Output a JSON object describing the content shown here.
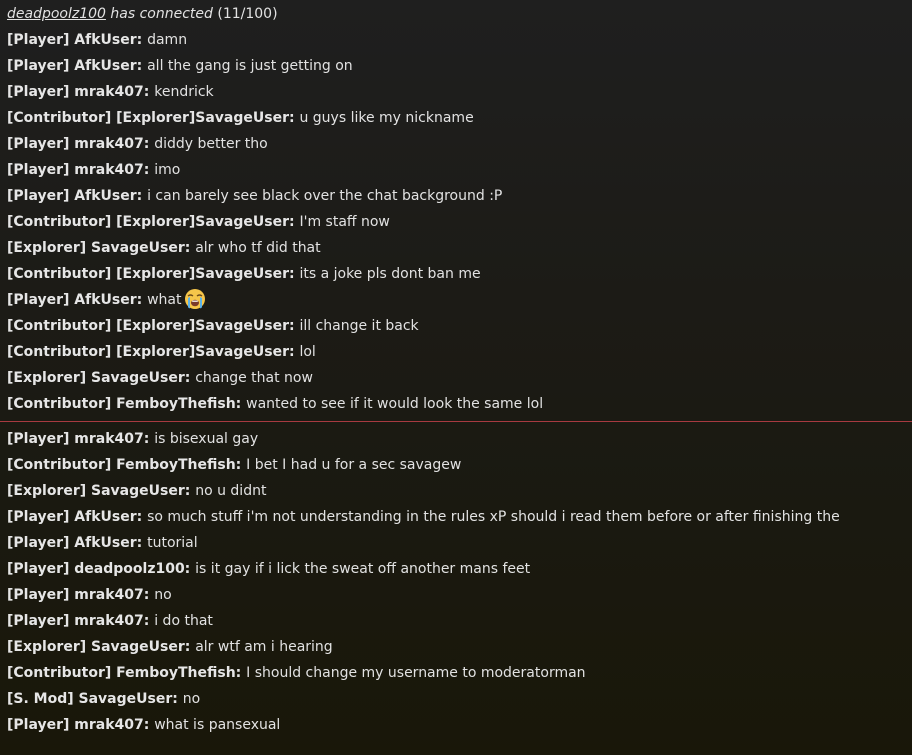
{
  "connection": {
    "user": "deadpoolz100",
    "text": " has connected",
    "count": " (11/100)"
  },
  "messages": [
    {
      "sender": "[Player] AfkUser:",
      "text": "damn"
    },
    {
      "sender": "[Player] AfkUser:",
      "text": "all the gang is just getting on"
    },
    {
      "sender": "[Player] mrak407:",
      "text": "kendrick"
    },
    {
      "sender": "[Contributor] [Explorer]SavageUser:",
      "text": "u guys like my nickname"
    },
    {
      "sender": "[Player] mrak407:",
      "text": "diddy better tho"
    },
    {
      "sender": "[Player] mrak407:",
      "text": "imo"
    },
    {
      "sender": "[Player] AfkUser:",
      "text": "i can barely see black over the chat background :P"
    },
    {
      "sender": "[Contributor] [Explorer]SavageUser:",
      "text": "I'm staff now"
    },
    {
      "sender": "[Explorer] SavageUser:",
      "text": "alr who tf did that"
    },
    {
      "sender": "[Contributor] [Explorer]SavageUser:",
      "text": "its a joke pls dont ban me"
    },
    {
      "sender": "[Player] AfkUser:",
      "text": "what",
      "emoji": "loudly-crying-face-icon"
    },
    {
      "sender": "[Contributor] [Explorer]SavageUser:",
      "text": "ill change it back"
    },
    {
      "sender": "[Contributor] [Explorer]SavageUser:",
      "text": "lol"
    },
    {
      "sender": "[Explorer] SavageUser:",
      "text": "change that now"
    },
    {
      "sender": "[Contributor] FemboyThefish:",
      "text": "wanted to see if it would look the same lol"
    },
    {
      "sender": "[Player] mrak407:",
      "text": "is bisexual gay"
    },
    {
      "sender": "[Contributor] FemboyThefish:",
      "text": "I bet I had u for a sec savagew"
    },
    {
      "sender": "[Explorer] SavageUser:",
      "text": "no u didnt"
    },
    {
      "sender": "[Player] AfkUser:",
      "text": "so much stuff i'm not understanding in the rules xP should i read them before or after finishing the"
    },
    {
      "sender": "[Player] AfkUser:",
      "text": "tutorial"
    },
    {
      "sender": "[Player] deadpoolz100:",
      "text": "is it gay if i lick the sweat off another mans feet"
    },
    {
      "sender": "[Player] mrak407:",
      "text": "no"
    },
    {
      "sender": "[Player] mrak407:",
      "text": "i do that"
    },
    {
      "sender": "[Explorer] SavageUser:",
      "text": "alr wtf am i hearing"
    },
    {
      "sender": "[Contributor] FemboyThefish:",
      "text": "I should change my username to moderatorman"
    },
    {
      "sender": "[S. Mod] SavageUser:",
      "text": "no"
    },
    {
      "sender": "[Player] mrak407:",
      "text": "what is pansexual"
    }
  ],
  "colors": {
    "divider": "#a83a40",
    "text": "#e2e2e2",
    "background": "#1c1b16"
  }
}
